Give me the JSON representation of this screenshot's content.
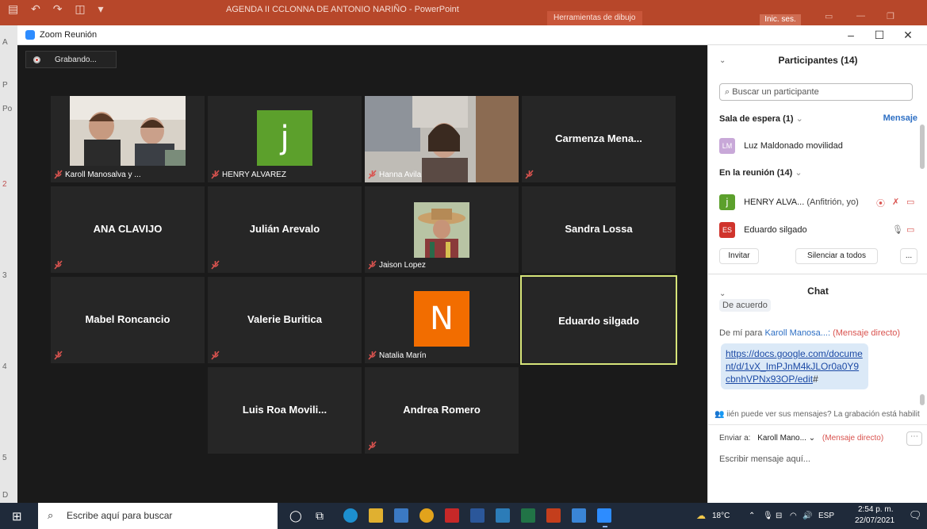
{
  "powerpoint": {
    "title": "AGENDA II CCLONNA DE ANTONIO NARIÑO - PowerPoint",
    "context_tab": "Herramientas de dibujo",
    "sign_in": "Inic. ses."
  },
  "window": {
    "title": "Zoom Reunión"
  },
  "recording": {
    "label": "Grabando..."
  },
  "tiles": [
    {
      "name": "Karoll Manosalva y ...",
      "kind": "video",
      "photo": "two-kids"
    },
    {
      "name": "HENRY ALVAREZ",
      "kind": "avatar",
      "letter": "j",
      "color": "#5ca02c"
    },
    {
      "name": "Hanna Avila",
      "kind": "video",
      "photo": "girl-headphones"
    },
    {
      "name": "Carmenza  Mena...",
      "kind": "name"
    },
    {
      "name": "ANA CLAVIJO",
      "kind": "name"
    },
    {
      "name": "Julián Arevalo",
      "kind": "name"
    },
    {
      "name": "Jaison Lopez",
      "kind": "video",
      "photo": "man-hat"
    },
    {
      "name": "Sandra Lossa",
      "kind": "name"
    },
    {
      "name": "Mabel Roncancio",
      "kind": "name"
    },
    {
      "name": "Valerie Buritica",
      "kind": "name"
    },
    {
      "name": "Natalia Marín",
      "kind": "avatar",
      "letter": "N",
      "color": "#f26d00"
    },
    {
      "name": "Eduardo silgado",
      "kind": "name",
      "active": true
    },
    {
      "name": "Luis Roa Movili...",
      "kind": "name"
    },
    {
      "name": "Andrea Romero",
      "kind": "name"
    }
  ],
  "participants": {
    "title": "Participantes (14)",
    "search_placeholder": "Buscar un participante",
    "waiting_room": "Sala de espera (1)",
    "message_link": "Mensaje",
    "waiting_person": {
      "initials": "LM",
      "name": "Luz Maldonado movilidad"
    },
    "in_meeting": "En la reunión (14)",
    "host": {
      "initial": "j",
      "name": "HENRY ALVA...",
      "role": "(Anfitrión, yo)"
    },
    "member": {
      "initials": "ES",
      "name": "Eduardo silgado"
    },
    "invite": "Invitar",
    "mute_all": "Silenciar a todos",
    "more": "..."
  },
  "chat": {
    "title": "Chat",
    "partial_msg": "De acuerdo",
    "from_prefix": "De mí para",
    "recipient": "Karoll Manosa...:",
    "direct_tag": "(Mensaje directo)",
    "link": "https://docs.google.com/document/d/1vX_ImPJnM4kJLOr0a0Y9cbnhVPNx93OP/edit",
    "link_suffix": "#",
    "notice": "iién puede ver sus mensajes? La grabación está habilit",
    "send_to_label": "Enviar a:",
    "send_to_value": "Karoll Mano...",
    "send_to_direct": "(Mensaje directo)",
    "input_placeholder": "Escribir mensaje aquí..."
  },
  "taskbar": {
    "search_placeholder": "Escribe aquí para buscar",
    "temperature": "18°C",
    "language": "ESP",
    "time": "2:54 p. m.",
    "date": "22/07/2021"
  },
  "colors": {
    "zoom_blue": "#2d8cff",
    "mute_red": "#d9534f",
    "active_border": "#d6e479",
    "ppt_red": "#b7472a"
  }
}
